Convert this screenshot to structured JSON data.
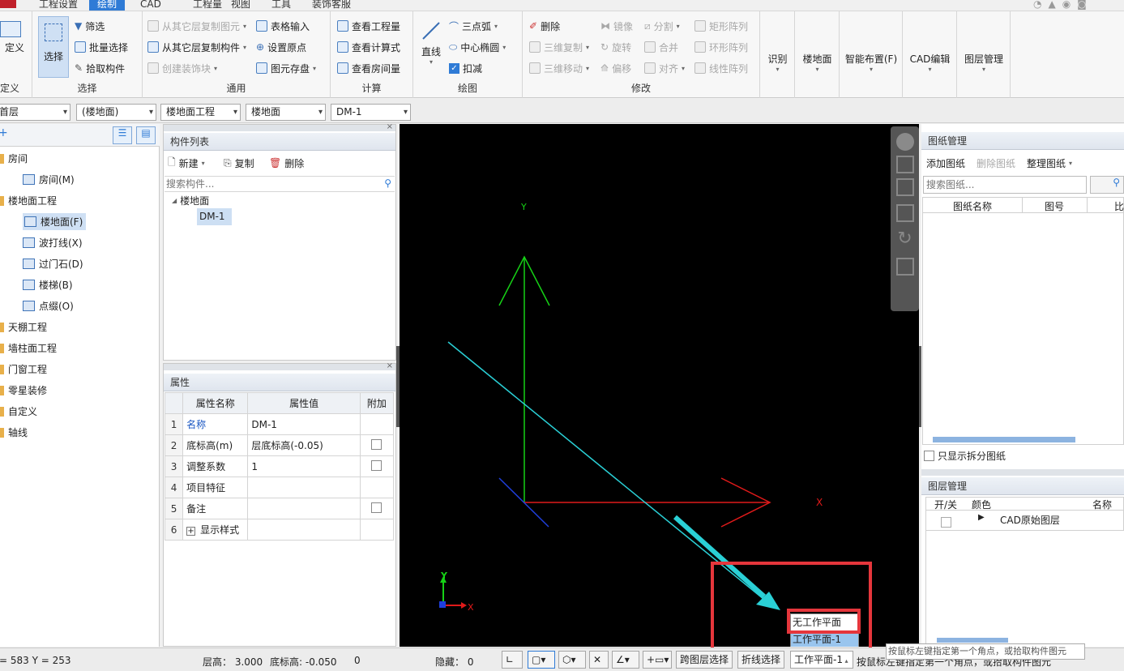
{
  "menu": {
    "items": [
      "工程设置",
      "绘制",
      "CAD",
      "工程量",
      "视图",
      "工具",
      "装饰客服"
    ],
    "active_index": 1
  },
  "ribbon": {
    "define_group": {
      "button": "定义",
      "label": "定义"
    },
    "select_group": {
      "select": "选择",
      "filter": "筛选",
      "batch_select": "批量选择",
      "pick": "拾取构件",
      "label": "选择"
    },
    "general_group": {
      "copy_layer_elem": "从其它层复制图元",
      "copy_layer_comp": "从其它层复制构件",
      "create_decor": "创建装饰块",
      "table_input": "表格输入",
      "set_origin": "设置原点",
      "elem_save": "图元存盘",
      "label": "通用"
    },
    "calc_group": {
      "view_qty": "查看工程量",
      "view_formula": "查看计算式",
      "view_room_qty": "查看房间量",
      "label": "计算"
    },
    "draw_group": {
      "line": "直线",
      "three_arc": "三点弧",
      "center_ellipse": "中心椭圆",
      "deduct": "扣减",
      "label": "绘图"
    },
    "modify_group": {
      "delete": "删除",
      "mirror": "镜像",
      "split": "分割",
      "rect_array": "矩形阵列",
      "copy3d": "三维复制",
      "rotate": "旋转",
      "merge": "合并",
      "ring_array": "环形阵列",
      "move3d": "三维移动",
      "offset": "偏移",
      "align": "对齐",
      "linear_array": "线性阵列",
      "label": "修改"
    },
    "recognize": "识别",
    "floor_surface": "楼地面",
    "smart_layout": "智能布置(F)",
    "cad_edit": "CAD编辑",
    "layer_mgmt": "图层管理"
  },
  "toolbar": {
    "combos": [
      "首层",
      "(楼地面)",
      "楼地面工程",
      "楼地面",
      "DM-1"
    ]
  },
  "tree": {
    "items": [
      {
        "label": "房间",
        "level": 0
      },
      {
        "label": "房间(M)",
        "level": 1
      },
      {
        "label": "楼地面工程",
        "level": 0
      },
      {
        "label": "楼地面(F)",
        "level": 1,
        "selected": true
      },
      {
        "label": "波打线(X)",
        "level": 1
      },
      {
        "label": "过门石(D)",
        "level": 1
      },
      {
        "label": "楼梯(B)",
        "level": 1
      },
      {
        "label": "点缀(O)",
        "level": 1
      },
      {
        "label": "天棚工程",
        "level": 0
      },
      {
        "label": "墙柱面工程",
        "level": 0
      },
      {
        "label": "门窗工程",
        "level": 0
      },
      {
        "label": "零星装修",
        "level": 0
      },
      {
        "label": "自定义",
        "level": 0
      },
      {
        "label": "轴线",
        "level": 0
      }
    ]
  },
  "component_list": {
    "title": "构件列表",
    "new": "新建",
    "copy": "复制",
    "delete": "删除",
    "search_placeholder": "搜索构件...",
    "root": "楼地面",
    "child": "DM-1"
  },
  "properties": {
    "title": "属性",
    "headers": [
      "属性名称",
      "属性值",
      "附加"
    ],
    "rows": [
      {
        "n": "1",
        "name": "名称",
        "value": "DM-1",
        "check": false
      },
      {
        "n": "2",
        "name": "底标高(m)",
        "value": "层底标高(-0.05)",
        "check": true
      },
      {
        "n": "3",
        "name": "调整系数",
        "value": "1",
        "check": true
      },
      {
        "n": "4",
        "name": "项目特征",
        "value": "",
        "check": false
      },
      {
        "n": "5",
        "name": "备注",
        "value": "",
        "check": true
      },
      {
        "n": "6",
        "name": "显示样式",
        "value": "",
        "check": false
      }
    ]
  },
  "canvas": {
    "axis_y": "Y",
    "axis_x": "X",
    "mini_y": "Y",
    "mini_x": "X",
    "dropdown_options": [
      "无工作平面",
      "工作平面-1"
    ]
  },
  "drawing_mgmt": {
    "title": "图纸管理",
    "add": "添加图纸",
    "delete": "删除图纸",
    "organize": "整理图纸",
    "search_placeholder": "搜索图纸...",
    "headers": [
      "图纸名称",
      "图号",
      "比"
    ],
    "only_split": "只显示拆分图纸"
  },
  "layer_mgmt": {
    "title": "图层管理",
    "headers": [
      "开/关",
      "颜色",
      "名称"
    ],
    "row": "CAD原始图层"
  },
  "status": {
    "coords": "= 583 Y = 253",
    "floor_height": "层高：  3.000",
    "base_elev": "底标高: -0.050",
    "zero": "0",
    "hidden": "隐藏：  0",
    "cross_layer": "跨图层选择",
    "polyline_select": "折线选择",
    "work_plane": "工作平面-1",
    "hint": "按鼠标左键指定第一个角点，或拾取构件图元",
    "tooltip": "按鼠标左键指定第一个角点，或拾取构件图元"
  }
}
